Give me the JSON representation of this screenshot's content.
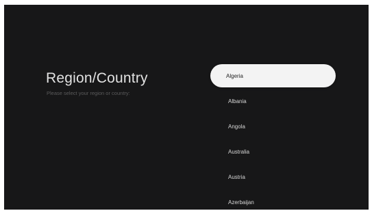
{
  "screen": {
    "title": "Region/Country",
    "subtitle": "Please select your region or country:"
  },
  "region_list": {
    "selected_index": 0,
    "items": [
      {
        "label": "Algeria"
      },
      {
        "label": "Albania"
      },
      {
        "label": "Angola"
      },
      {
        "label": "Australia"
      },
      {
        "label": "Austria"
      },
      {
        "label": "Azerbaijan"
      }
    ]
  },
  "colors": {
    "background": "#171718",
    "selected_item_bg": "#f3f3f3",
    "title_text": "#e2e2e2",
    "item_text": "#d6d6d6"
  }
}
